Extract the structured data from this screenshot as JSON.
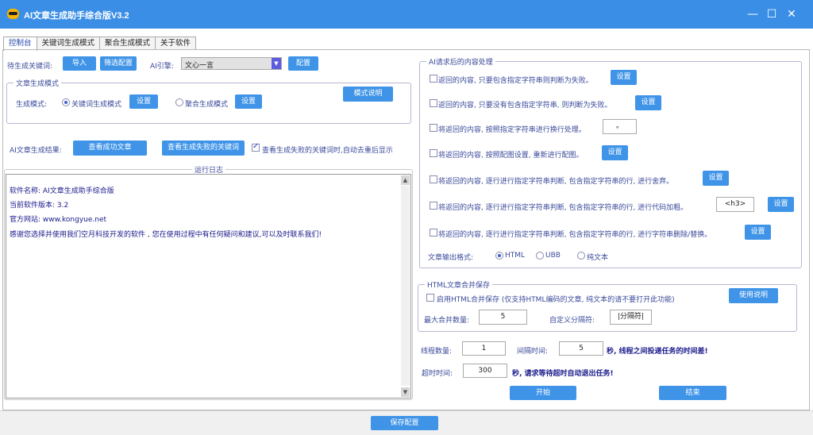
{
  "window": {
    "title": "AI文章生成助手综合版V3.2",
    "minimize": "—",
    "maximize": "☐",
    "close": "✕"
  },
  "tabs": [
    "控制台",
    "关键词生成模式",
    "聚合生成模式",
    "关于软件"
  ],
  "keywords": {
    "label": "待生成关键词:",
    "import_button": "导入",
    "filter_button": "筛选配置",
    "engine_label": "AI引擎:",
    "engine_value": "文心一言",
    "config_button": "配置"
  },
  "gen_mode": {
    "legend": "文章生成模式",
    "label": "生成模式:",
    "option_keyword": "关键词生成模式",
    "option_keyword_selected": true,
    "settings1": "设置",
    "option_aggregate": "聚合生成模式",
    "settings2": "设置",
    "help_button": "模式说明"
  },
  "results": {
    "label": "AI文章生成结果:",
    "view_success": "查看成功文章",
    "view_failed": "查看生成失败的关键词",
    "dedup_label": "查看生成失败的关键词时,自动去重后显示",
    "dedup_checked": true
  },
  "log": {
    "title": "运行日志",
    "lines": [
      "软件名称: AI文章生成助手综合版",
      "当前软件版本: 3.2",
      "官方网站: www.kongyue.net",
      "感谢您选择并使用我们空月科技开发的软件 , 您在使用过程中有任何疑问和建议,可以及时联系我们!"
    ]
  },
  "post": {
    "legend": "AI请求后的内容处理",
    "rules": [
      {
        "text": "返回的内容, 只要包含指定字符串则判断为失败。",
        "button": "设置"
      },
      {
        "text": "返回的内容, 只要没有包含指定字符串, 则判断为失败。",
        "button": "设置"
      },
      {
        "text": "将返回的内容, 按照指定字符串进行换行处理。",
        "field": "。"
      },
      {
        "text": "将返回的内容, 按照配图设置, 重新进行配图。",
        "button": "设置"
      },
      {
        "text": "将返回的内容, 逐行进行指定字符串判断, 包含指定字符串的行, 进行舍弃。",
        "button": "设置"
      },
      {
        "text": "将返回的内容, 逐行进行指定字符串判断, 包含指定字符串的行, 进行代码加粗。",
        "field": "<h3>",
        "button": "设置"
      },
      {
        "text": "将返回的内容, 逐行进行指定字符串判断, 包含指定字符串的行, 进行字符串删除/替换。",
        "button": "设置"
      }
    ],
    "format_label": "文章输出格式:",
    "formats": [
      "HTML",
      "UBB",
      "纯文本"
    ],
    "format_selected": "HTML"
  },
  "merge": {
    "legend": "HTML文章合并保存",
    "enable_label": "启用HTML合并保存 (仅支持HTML编码的文章, 纯文本的请不要打开此功能)",
    "help_button": "使用说明",
    "max_label": "最大合并数量:",
    "max_value": "5",
    "sep_label": "自定义分隔符:",
    "sep_value": "|分隔符|"
  },
  "run": {
    "threads_label": "线程数量:",
    "threads_value": "1",
    "interval_label": "间隔时间:",
    "interval_value": "5",
    "interval_note": "秒, 线程之间投递任务的时间差!",
    "timeout_label": "超时时间:",
    "timeout_value": "300",
    "timeout_note": "秒, 请求等待超时自动退出任务!",
    "start": "开始",
    "stop": "结束"
  },
  "footer": {
    "save": "保存配置"
  },
  "colors": {
    "titlebar": "#3a8ee6",
    "button": "#3f94e8",
    "label_text": "#3b4a9a",
    "log_text": "#1a1a8c"
  }
}
